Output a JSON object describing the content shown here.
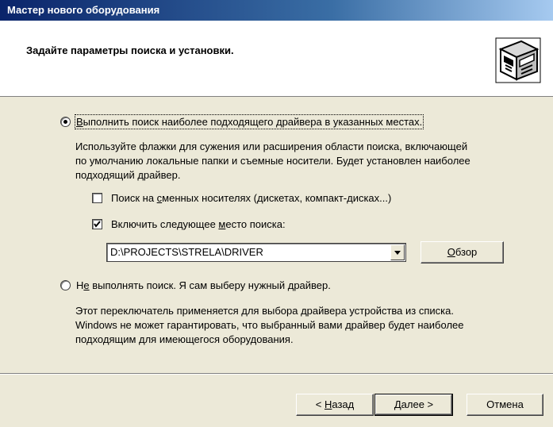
{
  "window": {
    "title": "Мастер нового оборудования"
  },
  "header": {
    "title": "Задайте параметры поиска и установки.",
    "icon": "hardware-wizard-icon"
  },
  "option_search": {
    "label_pre": "",
    "label_accel": "В",
    "label_post": "ыполнить поиск наиболее подходящего драйвера в указанных местах.",
    "selected": true,
    "description_lines": [
      "Используйте флажки для сужения или расширения области поиска, включающей",
      "по умолчанию локальные папки и съемные носители. Будет установлен наиболее",
      "подходящий драйвер."
    ],
    "removable": {
      "label_pre": "Поиск на ",
      "label_accel": "с",
      "label_post": "менных носителях (дискетах, компакт-дисках...)",
      "checked": false
    },
    "include_location": {
      "label_pre": "Включить следующее ",
      "label_accel": "м",
      "label_post": "есто поиска:",
      "checked": true
    },
    "path_value": "D:\\PROJECTS\\STRELA\\DRIVER",
    "browse": {
      "label_pre": "",
      "label_accel": "О",
      "label_post": "бзор"
    }
  },
  "option_manual": {
    "label_pre": "Н",
    "label_accel": "е",
    "label_post": " выполнять поиск. Я сам выберу нужный драйвер.",
    "selected": false,
    "description_lines": [
      "Этот переключатель применяется для выбора драйвера устройства из списка.",
      "Windows не может гарантировать, что выбранный вами драйвер будет наиболее",
      "подходящим для имеющегося оборудования."
    ]
  },
  "footer": {
    "back": {
      "label_pre": "< ",
      "label_accel": "Н",
      "label_post": "азад"
    },
    "next": {
      "label_pre": "",
      "label_accel": "Д",
      "label_post": "алее >"
    },
    "cancel": {
      "label": "Отмена"
    }
  }
}
